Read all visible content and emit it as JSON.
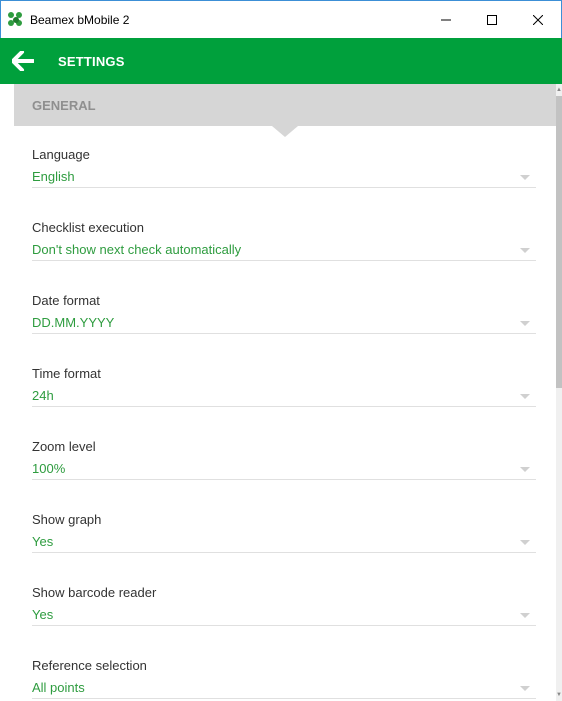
{
  "window": {
    "title": "Beamex bMobile 2",
    "minimize_glyph": "—",
    "maximize_glyph": "☐",
    "close_glyph": "✕"
  },
  "appbar": {
    "title": "SETTINGS",
    "back_icon": "arrow-left-icon",
    "color": "#00a03c"
  },
  "section": {
    "title": "GENERAL"
  },
  "settings": [
    {
      "label": "Language",
      "value": "English"
    },
    {
      "label": "Checklist execution",
      "value": "Don't show next check automatically"
    },
    {
      "label": "Date format",
      "value": "DD.MM.YYYY"
    },
    {
      "label": "Time format",
      "value": "24h"
    },
    {
      "label": "Zoom level",
      "value": "100%"
    },
    {
      "label": "Show graph",
      "value": "Yes"
    },
    {
      "label": "Show barcode reader",
      "value": "Yes"
    },
    {
      "label": "Reference selection",
      "value": "All points"
    }
  ],
  "colors": {
    "accent": "#00a03c",
    "value_text": "#2e9c3f",
    "section_bg": "#d6d6d6"
  }
}
